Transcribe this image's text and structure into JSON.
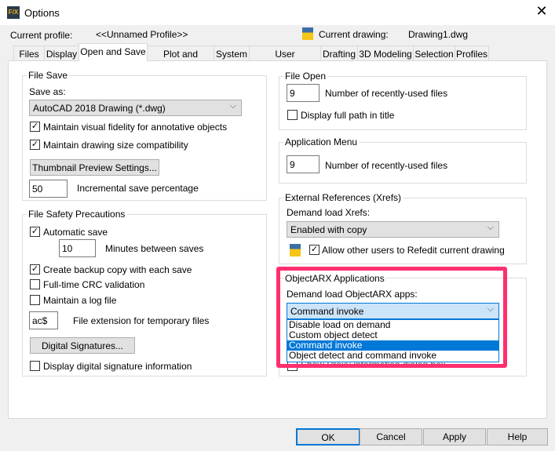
{
  "window": {
    "title": "Options",
    "close": "✕",
    "icon": "F/X"
  },
  "header": {
    "profile_label": "Current profile:",
    "profile_value": "<<Unnamed Profile>>",
    "drawing_label": "Current drawing:",
    "drawing_value": "Drawing1.dwg"
  },
  "tabs": [
    "Files",
    "Display",
    "Open and Save",
    "Plot and Publish",
    "System",
    "User Preferences",
    "Drafting",
    "3D Modeling",
    "Selection",
    "Profiles"
  ],
  "active_tab": "Open and Save",
  "file_save": {
    "title": "File Save",
    "save_as_label": "Save as:",
    "save_as_value": "AutoCAD 2018 Drawing (*.dwg)",
    "visual_fidelity": "Maintain visual fidelity for annotative objects",
    "visual_fidelity_checked": true,
    "drawing_size": "Maintain drawing size compatibility",
    "drawing_size_checked": true,
    "thumbnail_button": "Thumbnail Preview Settings...",
    "incremental_value": "50",
    "incremental_label": "Incremental save percentage"
  },
  "file_safety": {
    "title": "File Safety Precautions",
    "autosave": "Automatic save",
    "autosave_checked": true,
    "minutes_value": "10",
    "minutes_label": "Minutes between saves",
    "backup": "Create backup copy with each save",
    "backup_checked": true,
    "crc": "Full-time CRC validation",
    "crc_checked": false,
    "log": "Maintain a log file",
    "log_checked": false,
    "ext_value": "ac$",
    "ext_label": "File extension for temporary files",
    "digsig_button": "Digital Signatures...",
    "digsig_info": "Display digital signature information",
    "digsig_checked": false
  },
  "file_open": {
    "title": "File Open",
    "recent_value": "9",
    "recent_label": "Number of recently-used files",
    "full_path": "Display full path in title",
    "full_path_checked": false
  },
  "app_menu": {
    "title": "Application Menu",
    "recent_value": "9",
    "recent_label": "Number of recently-used files"
  },
  "xrefs": {
    "title": "External References (Xrefs)",
    "demand_label": "Demand load Xrefs:",
    "demand_value": "Enabled with copy",
    "refedit": "Allow other users to Refedit current drawing",
    "refedit_checked": true
  },
  "objectarx": {
    "title": "ObjectARX Applications",
    "demand_label": "Demand load ObjectARX apps:",
    "demand_value": "Command invoke",
    "options": [
      "Disable load on demand",
      "Custom object detect",
      "Command invoke",
      "Object detect and command invoke"
    ],
    "selected_index": 2,
    "hidden_checkbox": "Show Proxy information dialog box"
  },
  "highlight_color": "#ff2f6e",
  "buttons": {
    "ok": "OK",
    "cancel": "Cancel",
    "apply": "Apply",
    "help": "Help"
  }
}
